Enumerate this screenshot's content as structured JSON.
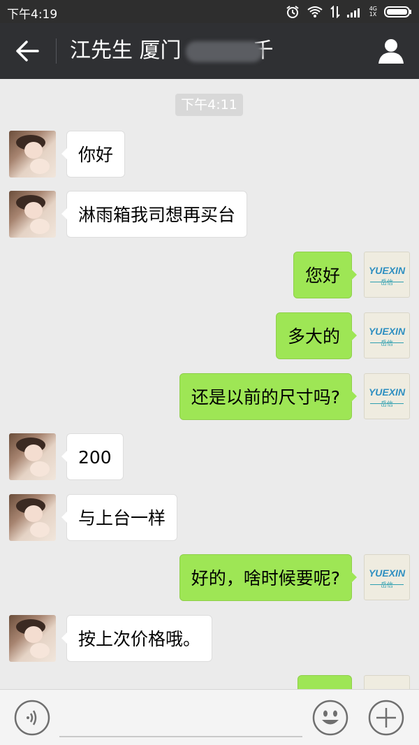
{
  "status_bar": {
    "time": "下午4:19",
    "network_label": "4G\n1X"
  },
  "header": {
    "title": "江先生 厦门",
    "title_suffix": "千"
  },
  "chat": {
    "timestamp": "下午4:11",
    "messages": [
      {
        "side": "in",
        "text": "你好"
      },
      {
        "side": "in",
        "text": "淋雨箱我司想再买台"
      },
      {
        "side": "out",
        "text": "您好"
      },
      {
        "side": "out",
        "text": "多大的"
      },
      {
        "side": "out",
        "text": "还是以前的尺寸吗?"
      },
      {
        "side": "in",
        "text": "200"
      },
      {
        "side": "in",
        "text": "与上台一样"
      },
      {
        "side": "out",
        "text": "好的，啥时候要呢?"
      },
      {
        "side": "in",
        "text": "按上次价格哦。"
      },
      {
        "side": "out",
        "text": ""
      }
    ],
    "company_avatar_text": "YUEXIN",
    "company_avatar_sub": "岳信"
  },
  "colors": {
    "outgoing_bubble": "#9ee655",
    "incoming_bubble": "#ffffff",
    "header_bg": "#2f3033",
    "status_bg": "#2e2e2e",
    "chat_bg": "#ebebeb"
  }
}
